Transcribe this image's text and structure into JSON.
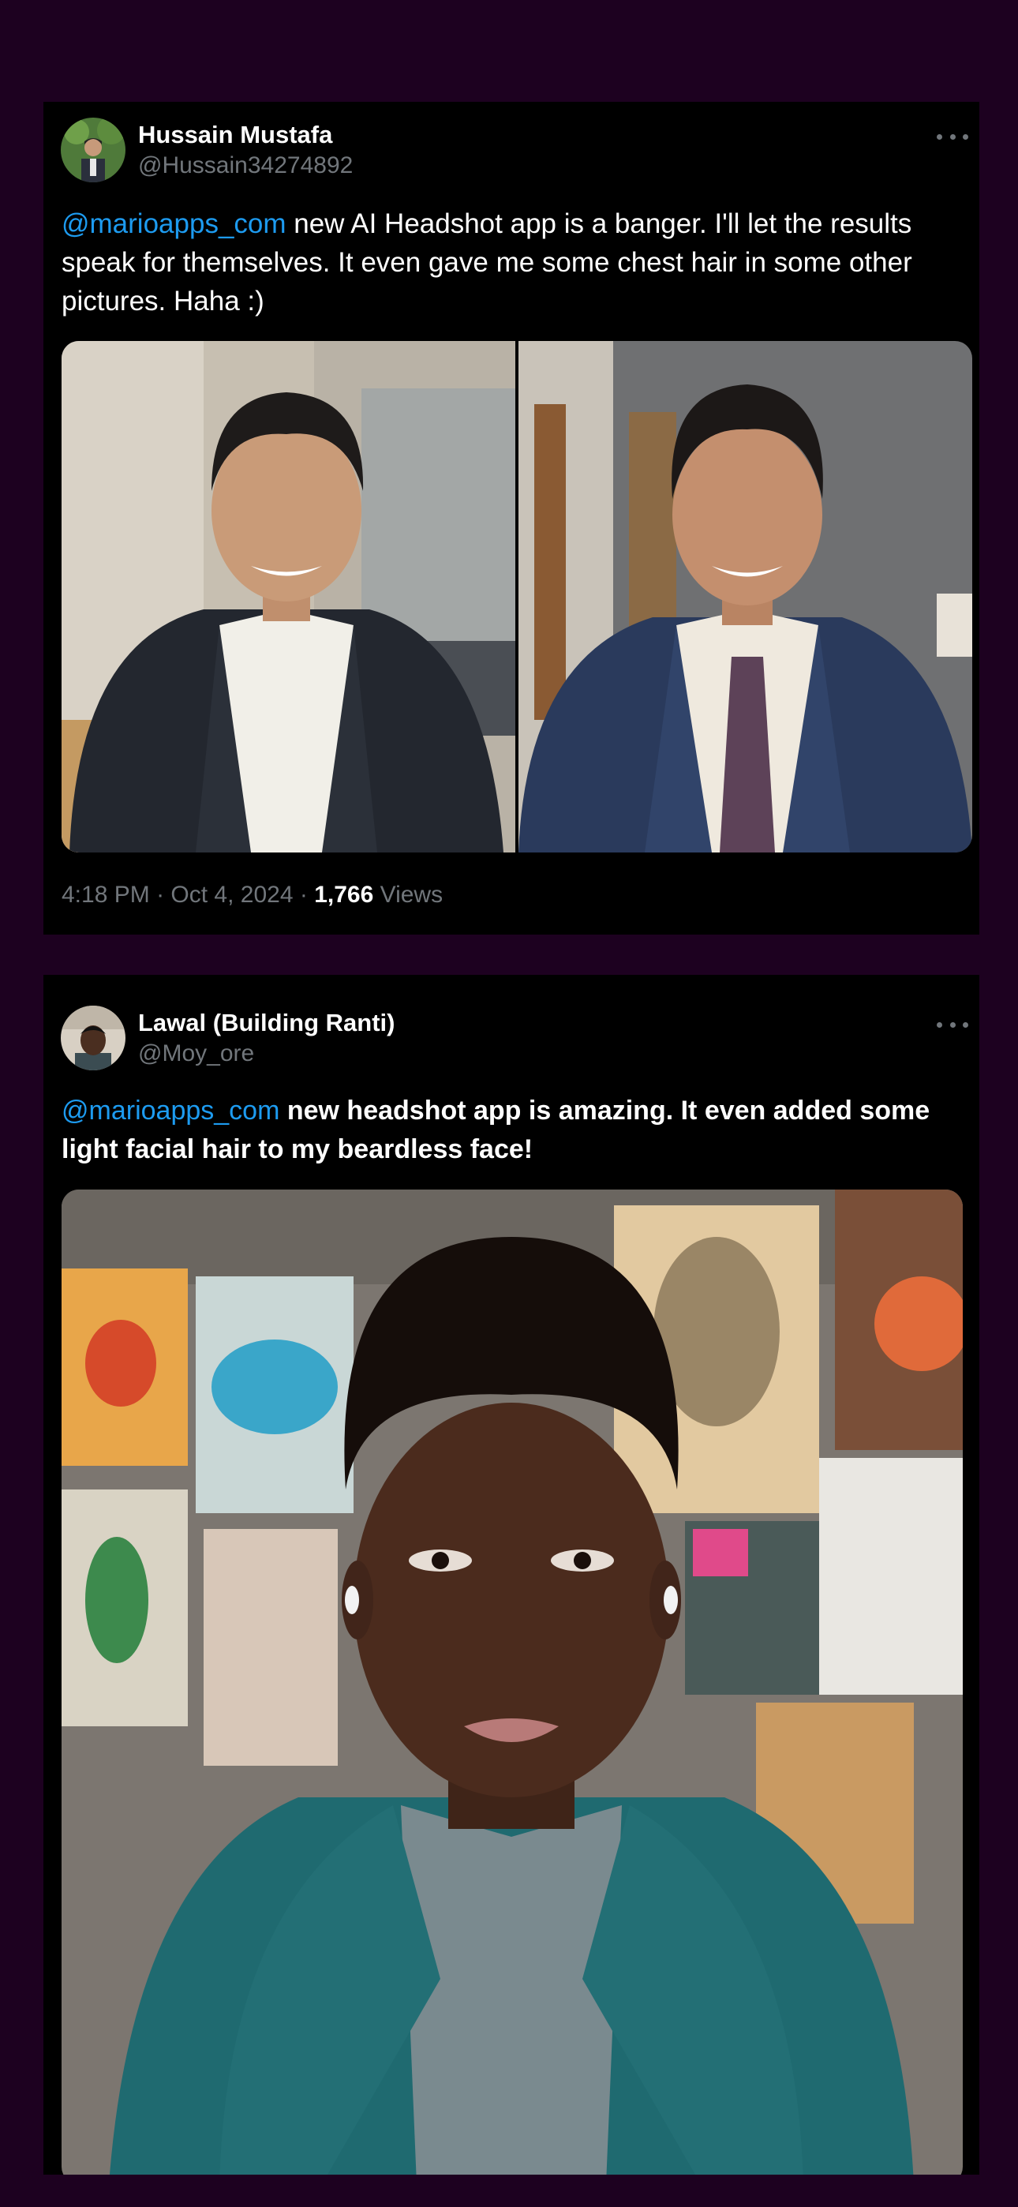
{
  "tweets": [
    {
      "name": "Hussain Mustafa",
      "handle": "@Hussain34274892",
      "mention": "@marioapps_com",
      "body": " new AI Headshot app is a banger. I'll let the results speak for themselves. It even gave me some chest hair in some other pictures. Haha :)",
      "time": "4:18 PM",
      "date": "Oct 4, 2024",
      "views_count": "1,766",
      "views_label": "Views",
      "avatar_icon": "profile-photo",
      "more_icon": "ellipsis-icon"
    },
    {
      "name": "Lawal (Building Ranti)",
      "handle": "@Moy_ore",
      "mention": "@marioapps_com",
      "body": "  new headshot app is amazing. It even added some light facial hair to my beardless face!",
      "avatar_icon": "profile-photo",
      "more_icon": "ellipsis-icon"
    }
  ],
  "colors": {
    "page_background": "#1d0120",
    "card_background": "#000000",
    "mention": "#1d9bf0",
    "secondary_text": "#71767b"
  }
}
